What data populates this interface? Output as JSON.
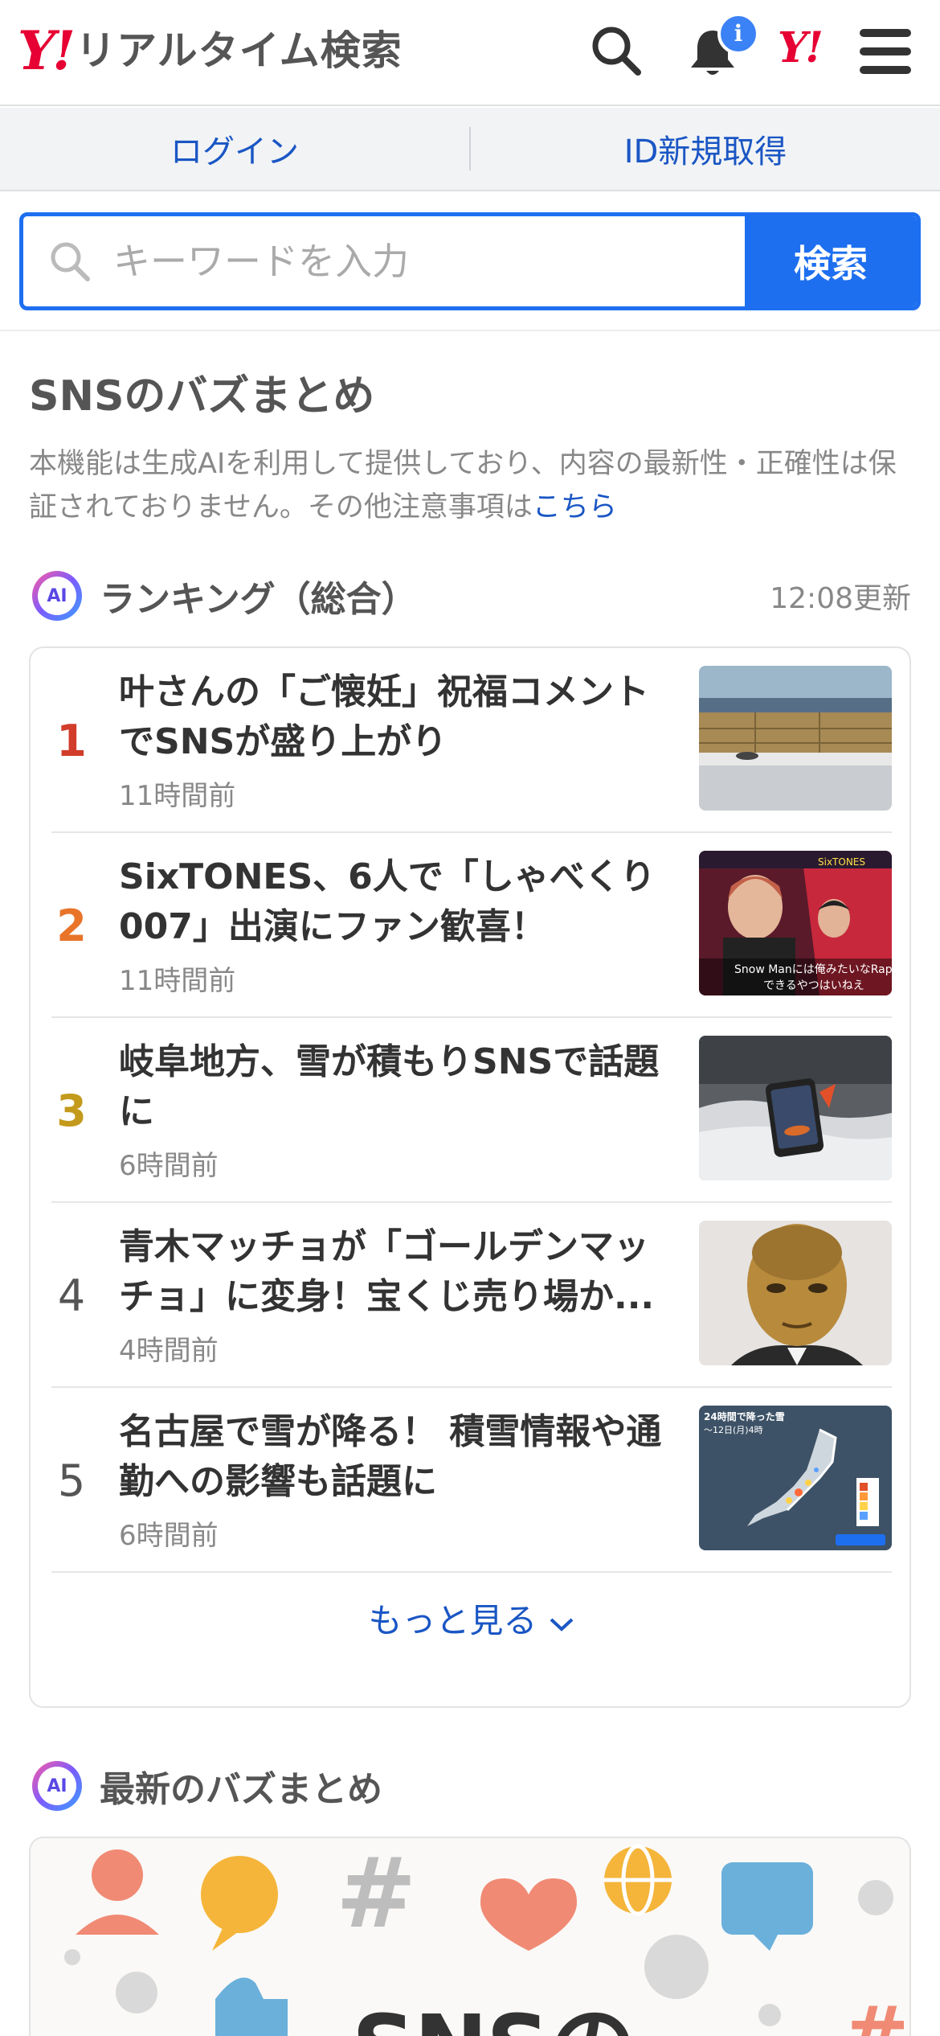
{
  "header": {
    "logo_mark": "Y!",
    "logo_text": "リアルタイム検索",
    "notification_badge": "i",
    "yahoo_japan_mark": "Y!"
  },
  "auth": {
    "login": "ログイン",
    "register": "ID新規取得"
  },
  "search": {
    "placeholder": "キーワードを入力",
    "button": "検索"
  },
  "section": {
    "title": "SNSのバズまとめ",
    "disclaimer": "本機能は生成AIを利用して提供しており、内容の最新性・正確性は保証されておりません。その他注意事項は",
    "disclaimer_link": "こちら"
  },
  "ranking": {
    "ai_badge": "AI",
    "title": "ランキング（総合）",
    "updated": "12:08更新",
    "items": [
      {
        "rank": "1",
        "title": "叶さんの「ご懐妊」祝福コメントでSNSが盛り上がり",
        "time": "11時間前",
        "thumb": "seaside-wall-photo"
      },
      {
        "rank": "2",
        "title": "SixTONES、6人で「しゃべくり007」出演にファン歓喜！",
        "time": "11時間前",
        "thumb": "tv-show-photo"
      },
      {
        "rank": "3",
        "title": "岐阜地方、雪が積もりSNSで話題に",
        "time": "6時間前",
        "thumb": "snow-phone-photo"
      },
      {
        "rank": "4",
        "title": "青木マッチョが「ゴールデンマッチョ」に変身！宝くじ売り場か...",
        "time": "4時間前",
        "thumb": "gold-face-photo"
      },
      {
        "rank": "5",
        "title": "名古屋で雪が降る！ 積雪情報や通勤への影響も話題に",
        "time": "6時間前",
        "thumb": "snow-map-photo"
      }
    ],
    "rank_colors": [
      "#d23c2a",
      "#e8742a",
      "#c49a1c",
      "#555555",
      "#555555"
    ],
    "more": "もっと見る"
  },
  "thumb_text": {
    "tv_caption_1": "Snow Manには俺みたいなRap",
    "tv_caption_2": "できるやつはいねえ",
    "tv_banner": "SixTONES",
    "map_title": "24時間で降った雪",
    "map_sub": "〜12日(月)4時"
  },
  "latest": {
    "ai_badge": "AI",
    "title": "最新のバズまとめ",
    "banner_text": "SNSの"
  },
  "colors": {
    "brand_red": "#e60033",
    "link_blue": "#1a56c4",
    "search_blue": "#1e6ff0"
  }
}
